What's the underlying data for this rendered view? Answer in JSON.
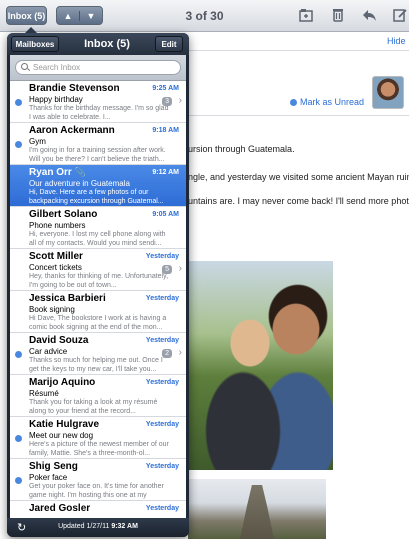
{
  "toolbar": {
    "inbox_button": "Inbox (5)",
    "prev_icon": "chevron-up-icon",
    "next_icon": "chevron-down-icon",
    "counter": "3 of 30",
    "icons": [
      "folder-icon",
      "trash-icon",
      "reply-icon",
      "compose-icon"
    ]
  },
  "message": {
    "hide_link": "Hide",
    "mark_unread": "Mark as Unread",
    "body_lines": [
      "ursion through Guatemala.",
      "ngle, and yesterday we visited some ancient Mayan ruins.",
      "untains are. I may never come back! I'll send more photos"
    ]
  },
  "popover": {
    "mailboxes_button": "Mailboxes",
    "title": "Inbox (5)",
    "edit_button": "Edit",
    "search_placeholder": "Search Inbox",
    "footer": {
      "updated_label": "Updated",
      "date": "1/27/11",
      "time": "9:32 AM"
    }
  },
  "messages": [
    {
      "sender": "Brandie Stevenson",
      "date": "9:25 AM",
      "subject": "Happy birthday",
      "preview": "Thanks for the birthday message. I'm so glad I was able to celebrate. I...",
      "unread": true,
      "thread_count": "3"
    },
    {
      "sender": "Aaron Ackermann",
      "date": "9:18 AM",
      "subject": "Gym",
      "preview": "I'm going in for a training session after work. Will you be there? I can't believe the triath...",
      "unread": true
    },
    {
      "sender": "Ryan Orr",
      "date": "9:12 AM",
      "subject": "Our adventure in Guatemala",
      "preview": "Hi, Dave. Here are a few photos of our backpacking excursion through Guatemal...",
      "unread": false,
      "selected": true,
      "attachment": true
    },
    {
      "sender": "Gilbert Solano",
      "date": "9:05 AM",
      "subject": "Phone numbers",
      "preview": "Hi, everyone. I lost my cell phone along with all of my contacts. Would you mind sendi...",
      "unread": false
    },
    {
      "sender": "Scott Miller",
      "date": "Yesterday",
      "subject": "Concert tickets",
      "preview": "Hey, thanks for thinking of me. Unfortunately, I'm going to be out of town...",
      "unread": false,
      "thread_count": "5"
    },
    {
      "sender": "Jessica Barbieri",
      "date": "Yesterday",
      "subject": "Book signing",
      "preview": "Hi Dave, The bookstore I work at is having a comic book signing at the end of the mon...",
      "unread": false
    },
    {
      "sender": "David Souza",
      "date": "Yesterday",
      "subject": "Car advice",
      "preview": "Thanks so much for helping me out. Once I get the keys to my new car, I'll take you...",
      "unread": true,
      "thread_count": "2"
    },
    {
      "sender": "Marijo Aquino",
      "date": "Yesterday",
      "subject": "Résumé",
      "preview": "Thank you for taking a look at my résumé along to your friend at the record...",
      "unread": false
    },
    {
      "sender": "Katie Hulgrave",
      "date": "Yesterday",
      "subject": "Meet our new dog",
      "preview": "Here's a picture of the newest member of our family, Mattie. She's a three-month-ol...",
      "unread": true
    },
    {
      "sender": "Shig Seng",
      "date": "Yesterday",
      "subject": "Poker face",
      "preview": "Get your poker face on. It's time for another game night. I'm hosting this one at my place...",
      "unread": true
    },
    {
      "sender": "Jared Gosler",
      "date": "Yesterday",
      "subject": "",
      "preview": "",
      "unread": false
    }
  ]
}
